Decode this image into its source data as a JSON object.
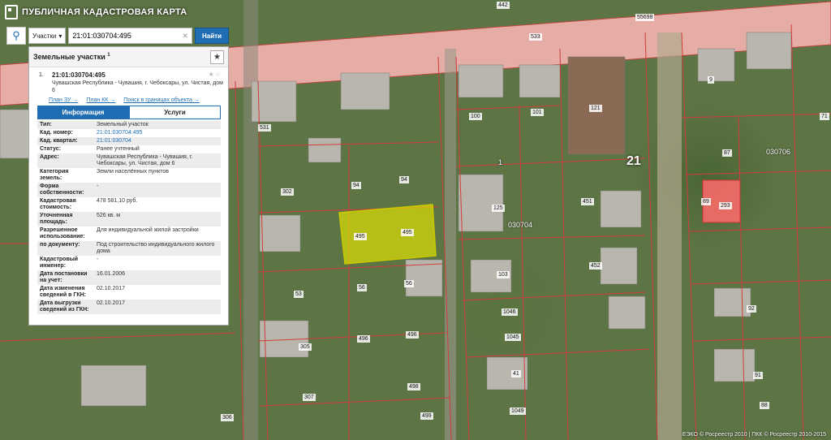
{
  "app": {
    "title": "ПУБЛИЧНАЯ КАДАСТРОВАЯ КАРТА"
  },
  "search": {
    "type_label": "Участки",
    "query": "21:01:030704:495",
    "submit_label": "Найти"
  },
  "panel": {
    "title": "Земельные участки",
    "count": "1",
    "item": {
      "num": "1.",
      "cad": "21:01:030704:495",
      "address": "Чувашская Республика - Чувашия, г. Чебоксары, ул. Чистая, дом 6",
      "links": [
        "План ЗУ →",
        "План КК →",
        "Поиск в границах объекта →"
      ]
    },
    "tabs": [
      "Информация",
      "Услуги"
    ],
    "info": [
      {
        "k": "Тип:",
        "v": "Земельный участок"
      },
      {
        "k": "Кад. номер:",
        "v": "21:01:030704:495",
        "link": true
      },
      {
        "k": "Кад. квартал:",
        "v": "21:01:030704",
        "link": true
      },
      {
        "k": "Статус:",
        "v": "Ранее учтенный"
      },
      {
        "k": "Адрес:",
        "v": "Чувашская Республика - Чувашия, г. Чебоксары, ул. Чистая, дом 6"
      },
      {
        "k": "Категория земель:",
        "v": "Земли населённых пунктов"
      },
      {
        "k": "Форма собственности:",
        "v": "-"
      },
      {
        "k": "Кадастровая стоимость:",
        "v": "478 581,10 руб."
      },
      {
        "k": "Уточненная площадь:",
        "v": "526 кв. м"
      },
      {
        "k": "Разрешенное использование:",
        "v": "Для индивидуальной жилой застройки"
      },
      {
        "k": "по документу:",
        "v": "Под строительство индивидуального жилого дома"
      },
      {
        "k": "Кадастровый инженер:",
        "v": "-"
      },
      {
        "k": "Дата постановки на учет:",
        "v": "16.01.2006"
      },
      {
        "k": "Дата изменения сведений в ГКН:",
        "v": "02.10.2017"
      },
      {
        "k": "Дата выгрузки сведений из ГКН:",
        "v": "02.10.2017"
      }
    ]
  },
  "map": {
    "labels": [
      "442",
      "533",
      "55698",
      "531",
      "302",
      "94",
      "94",
      "495",
      "495",
      "56",
      "56",
      "53",
      "496",
      "496",
      "305",
      "307",
      "306",
      "498",
      "499",
      "100",
      "101",
      "121",
      "1",
      "125",
      "030704",
      "451",
      "452",
      "103",
      "1046",
      "1045",
      "41",
      "1049",
      "9",
      "87",
      "030706",
      "89",
      "293",
      "71",
      "92",
      "91",
      "88"
    ],
    "big_label": "21",
    "copyright": "ЕЭКО © Росреестр 2010 | ПКК © Росреестр 2010-2015"
  },
  "colors": {
    "accent": "#1f6db3",
    "selected_parcel": "#e6e600",
    "highlight_parcel": "#ff6b6b",
    "road_zone": "#ffb3b3"
  }
}
